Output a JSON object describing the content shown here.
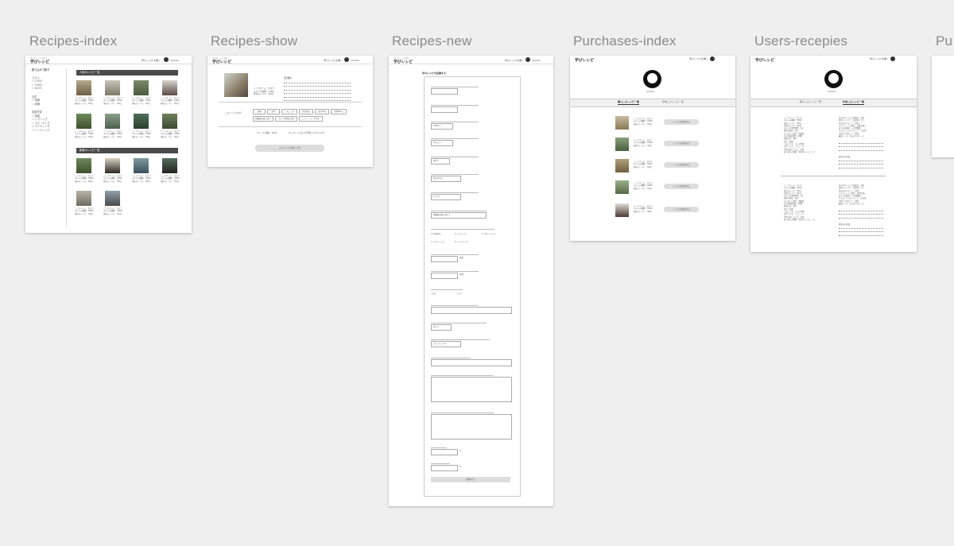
{
  "titles": {
    "recipes_index": "Recipes-index",
    "recipes_show": "Recipes-show",
    "recipes_new": "Recipes-new",
    "purchases_index": "Purchases-index",
    "users_recepies": "Users-recepies",
    "cut_off": "Pu"
  },
  "header": {
    "logo_sub": "学びのレシピ共有",
    "logo": "学びレシピ",
    "link": "学びレシピを書く",
    "user": "minoriha"
  },
  "recipes_index": {
    "sidebar_title": "絞り込みで探す",
    "group1_title": "スキル",
    "group1_items": [
      "TOEIC",
      "TOEFL",
      "IELTS"
    ],
    "group2_title": "目的",
    "group2_items": [
      "就職",
      "転職"
    ],
    "group3_title": "英語学習",
    "group3_items": [
      "単語",
      "リスニング",
      "スピーキング",
      "ライティング",
      "リーディング"
    ],
    "section1": "人気のレシピ一覧",
    "section2": "新着のレシピ一覧",
    "card_line1": "ニックネーム：タロウ",
    "card_line2": "スキルの種類：TOEIC",
    "card_line3": "現在のレベル：780点"
  },
  "recipes_show": {
    "desc_heading": "自己紹介",
    "info_line1": "ニックネーム：タロウ",
    "info_line2": "スキルの種類：TOEIC",
    "info_line3": "現在のレベル：780点",
    "chips_label": "このレシピのタグ",
    "chips": [
      "就職",
      "独学",
      "リスニング",
      "単語暗記",
      "毎日30分",
      "目標800点",
      "問題集を繰り返す",
      "スキマ時間を活用",
      "シャドーイング中心"
    ],
    "check1": "レシピ価格：500円",
    "check2": "このレシピは 3 回 購入されています",
    "buy_button": "このレシピを購入する"
  },
  "recipes_new": {
    "heading": "学びレシピを投稿する",
    "submit": "投稿する",
    "selects": [
      "TOEIC",
      "1年以上",
      "独学",
      "毎日30分",
      "2ヶ月",
      "問題集を繰り返す",
      "スピーキング"
    ],
    "checkbox_options": [
      "単語暗記",
      "リスニング",
      "スピーキング",
      "ライティング",
      "リーディング"
    ],
    "radio_options": [
      "はい",
      "いいえ"
    ],
    "unit_time": "時間",
    "unit_percent": "%"
  },
  "purchases_index": {
    "username": "minoriha",
    "tab_active": "購入したレシピ一覧",
    "tab_other": "作成したレシピ一覧",
    "row_line1": "ニックネーム：タロウ",
    "row_line2": "スキルの種類：TOEIC",
    "row_line3": "現在のレベル：780点",
    "row_button": "レシピの詳細を見る"
  },
  "users_recepies": {
    "username": "minoriha",
    "tab_other": "購入したレシピ一覧",
    "tab_active": "作成したレシピ一覧",
    "left_lines": [
      "ニックネーム：タロウ",
      "スキルの種類：TOEIC",
      "現在のレベル：780点",
      "目標のスコア：900点",
      "スキルの習得期間：1年",
      "勉強の頻度：毎日",
      "主に使った教材：問題集",
      "1日の勉強時間：2時間",
      "勉強方法：独学",
      "目的：転職",
      "工夫した点：スキマ時間",
      "苦労した点：リスニング",
      "学習を楽しむ工夫：音楽",
      "取り組んだ順番：単語からリスニング"
    ],
    "right_lines": [
      "自分がやっていた勉強法：音読",
      "使用したアプリ：英単語アプリ",
      "毎日必ずやること：単語",
      "モチベーション維持：目標を書く",
      "おすすめ教材：公式問題集",
      "やらなくてよかったこと：文法書",
      "学習で大切なこと：継続",
      "最後に一言：がんばりましょう"
    ],
    "right_heading": "勉強法の詳細"
  },
  "colors": {
    "background": "#efefef",
    "bar": "#4a4a4a"
  }
}
